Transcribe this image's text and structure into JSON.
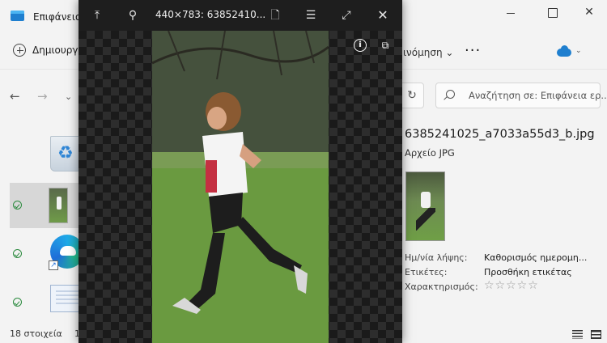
{
  "explorer": {
    "title": "Επιφάνεια",
    "new_label": "Δημιουργ",
    "sort_label": "ινόμηση ⌄",
    "more_label": "···",
    "search_placeholder": "Αναζήτηση σε: Επιφάνεια ερ...",
    "status_count": "18 στοιχεία",
    "status_extra": "1",
    "details": {
      "file_name": "6385241025_a7033a55d3_b.jpg",
      "file_type": "Αρχείο JPG",
      "props": [
        {
          "label": "Ημ/νία λήψης:",
          "value": "Καθορισμός ημερομη..."
        },
        {
          "label": "Ετικέτες:",
          "value": "Προσθήκη ετικέτας"
        },
        {
          "label": "Χαρακτηρισμός:",
          "value": ""
        }
      ],
      "rating": "☆☆☆☆☆"
    },
    "accent_color": "#1f7fcf"
  },
  "viewer": {
    "title": "440×783: 63852410...",
    "icons": [
      "pin-top-icon",
      "pin-icon",
      "file-icon",
      "list-icon",
      "fullscreen-icon",
      "close-icon"
    ]
  }
}
